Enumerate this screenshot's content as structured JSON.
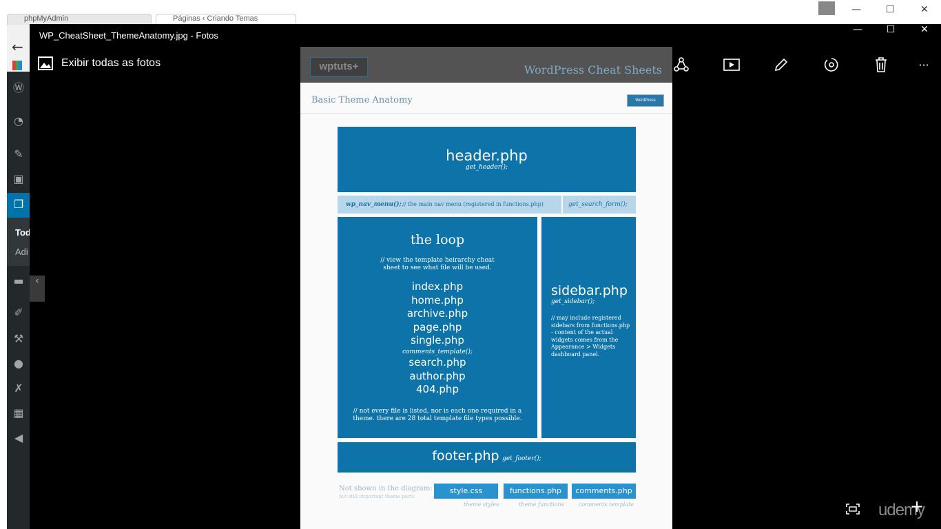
{
  "background_browser": {
    "tabs": [
      {
        "label": "phpMyAdmin"
      },
      {
        "label": "Páginas ‹ Criando Temas"
      }
    ],
    "sidebar_labels": [
      "Tod",
      "Adi"
    ]
  },
  "window": {
    "title": "WP_CheatSheet_ThemeAnatomy.jpg - Fotos",
    "minimize": "—",
    "maximize": "☐",
    "close": "✕"
  },
  "appbar": {
    "show_all_label": "Exibir todas as fotos",
    "more": "···"
  },
  "sheet": {
    "logo": "wptuts+",
    "heading": "WordPress Cheat Sheets",
    "subheading": "Basic Theme Anatomy",
    "badge": "WordPress",
    "header_title": "header.php",
    "header_fn": "get_header();",
    "nav_fn": "wp_nav_menu();",
    "nav_note": "// the main nav menu (registered in functions.php)",
    "search_fn": "get_search_form();",
    "loop_title": "the loop",
    "loop_note": "// view the template heirarchy cheat sheet to see what file will be used.",
    "loop_files": [
      "index.php",
      "home.php",
      "archive.php",
      "page.php",
      "single.php"
    ],
    "comments_fn": "comments_template();",
    "loop_files_2": [
      "search.php",
      "author.php",
      "404.php"
    ],
    "loop_footnote": "// not every file is listed, nor is each one required in a theme. there are 28 total template file types possible.",
    "sidebar_title": "sidebar.php",
    "sidebar_fn": "get_sidebar();",
    "sidebar_note": "// may include registered sidebars from functions.php - content of the actual widgets comes from the Appearance > Widgets dashboard panel.",
    "footer_title": "footer.php",
    "footer_fn": "get_footer();",
    "not_shown": "Not shown in the diagram:",
    "not_shown_sub": "but still important theme parts",
    "extras": [
      {
        "label": "style.css",
        "caption": "theme styles"
      },
      {
        "label": "functions.php",
        "caption": "theme functions"
      },
      {
        "label": "comments.php",
        "caption": "comments template"
      }
    ]
  },
  "watermark": "udemy",
  "colors": {
    "block_blue": "#0e73a8",
    "nav_blue": "#b7d6ea",
    "button_blue": "#2a92cf"
  }
}
